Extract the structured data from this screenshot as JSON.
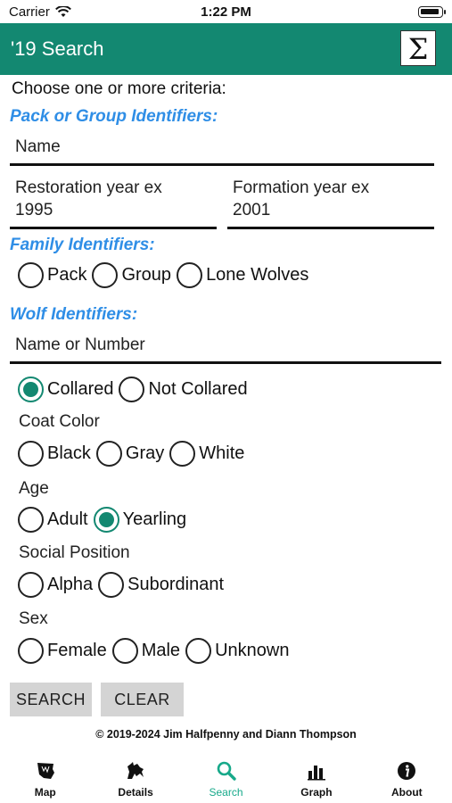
{
  "status_bar": {
    "carrier": "Carrier",
    "time": "1:22 PM"
  },
  "header": {
    "title": "'19 Search",
    "sigma": "Σ"
  },
  "prompt": "Choose one or more criteria:",
  "pack": {
    "heading": "Pack or Group Identifiers:",
    "name_placeholder": "Name",
    "restoration_placeholder_1": "Restoration year ex",
    "restoration_placeholder_2": "1995",
    "formation_placeholder_1": "Formation year ex",
    "formation_placeholder_2": "2001"
  },
  "family": {
    "heading": "Family Identifiers:",
    "options": [
      "Pack",
      "Group",
      "Lone Wolves"
    ]
  },
  "wolf": {
    "heading": "Wolf Identifiers:",
    "name_placeholder": "Name or Number",
    "collar_options": [
      "Collared",
      "Not Collared"
    ],
    "collar_selected": "Collared",
    "coat_label": "Coat Color",
    "coat_options": [
      "Black",
      "Gray",
      "White"
    ],
    "age_label": "Age",
    "age_options": [
      "Adult",
      "Yearling"
    ],
    "age_selected": "Yearling",
    "social_label": "Social Position",
    "social_options": [
      "Alpha",
      "Subordinant"
    ],
    "sex_label": "Sex",
    "sex_options": [
      "Female",
      "Male",
      "Unknown"
    ]
  },
  "buttons": {
    "search": "SEARCH",
    "clear": "CLEAR"
  },
  "copyright": "© 2019-2024 Jim Halfpenny and Diann Thompson",
  "tabs": [
    {
      "label": "Map",
      "icon": "map-icon"
    },
    {
      "label": "Details",
      "icon": "wolf-icon"
    },
    {
      "label": "Search",
      "icon": "search-icon"
    },
    {
      "label": "Graph",
      "icon": "bar-chart-icon"
    },
    {
      "label": "About",
      "icon": "info-icon"
    }
  ],
  "colors": {
    "accent": "#138871",
    "section_blue": "#2f8ee6",
    "active_tab": "#17a98a"
  }
}
